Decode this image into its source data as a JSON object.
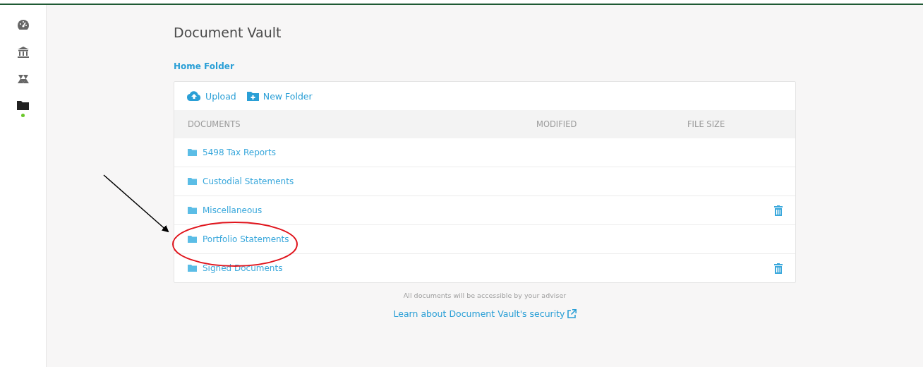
{
  "sidebar": {
    "items": [
      {
        "selected": false
      },
      {
        "selected": false
      },
      {
        "selected": false
      },
      {
        "selected": true
      }
    ]
  },
  "page": {
    "title": "Document Vault",
    "breadcrumb": "Home Folder"
  },
  "toolbar": [
    {
      "label": "Upload"
    },
    {
      "label": "New Folder"
    }
  ],
  "table": {
    "columns": [
      "DOCUMENTS",
      "MODIFIED",
      "FILE SIZE"
    ],
    "rows": [
      {
        "name": "5498 Tax Reports",
        "deletable": false
      },
      {
        "name": "Custodial Statements",
        "deletable": false
      },
      {
        "name": "Miscellaneous",
        "deletable": true
      },
      {
        "name": "Portfolio Statements",
        "deletable": false
      },
      {
        "name": "Signed Documents",
        "deletable": true
      }
    ]
  },
  "footer": {
    "note": "All documents will be accessible by your adviser",
    "link": "Learn about Document Vault's security"
  }
}
